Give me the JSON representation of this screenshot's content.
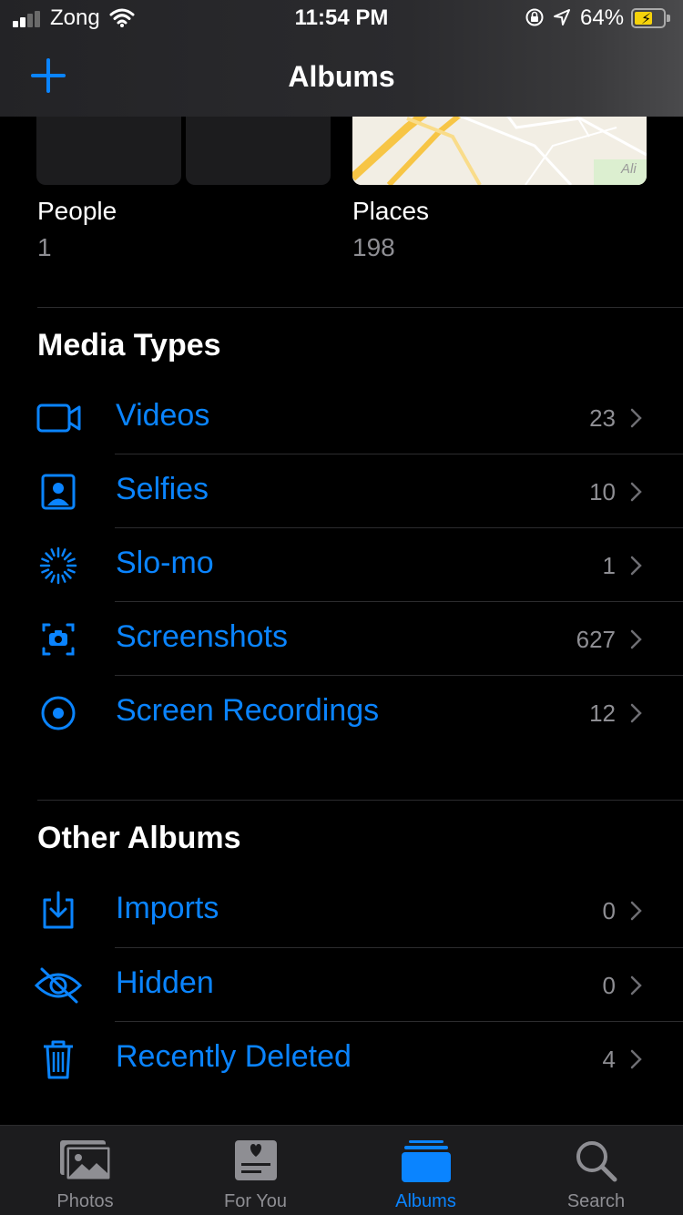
{
  "status": {
    "carrier": "Zong",
    "time": "11:54 PM",
    "battery_pct": "64%",
    "battery_level": 0.64
  },
  "nav": {
    "title": "Albums",
    "add_icon": "plus-icon"
  },
  "top_albums": [
    {
      "name": "People",
      "count": "1"
    },
    {
      "name": "Places",
      "count": "198",
      "map_label": "Ali"
    }
  ],
  "media_types": {
    "heading": "Media Types",
    "items": [
      {
        "label": "Videos",
        "count": "23",
        "icon": "video-camera-icon"
      },
      {
        "label": "Selfies",
        "count": "10",
        "icon": "selfie-portrait-icon"
      },
      {
        "label": "Slo-mo",
        "count": "1",
        "icon": "slo-mo-icon"
      },
      {
        "label": "Screenshots",
        "count": "627",
        "icon": "screenshot-icon"
      },
      {
        "label": "Screen Recordings",
        "count": "12",
        "icon": "screen-recording-icon"
      }
    ]
  },
  "other_albums": {
    "heading": "Other Albums",
    "items": [
      {
        "label": "Imports",
        "count": "0",
        "icon": "import-icon"
      },
      {
        "label": "Hidden",
        "count": "0",
        "icon": "hidden-eye-icon"
      },
      {
        "label": "Recently Deleted",
        "count": "4",
        "icon": "trash-icon"
      }
    ]
  },
  "tabs": [
    {
      "label": "Photos",
      "icon": "photos-icon",
      "active": false
    },
    {
      "label": "For You",
      "icon": "for-you-icon",
      "active": false
    },
    {
      "label": "Albums",
      "icon": "albums-icon",
      "active": true
    },
    {
      "label": "Search",
      "icon": "search-icon",
      "active": false
    }
  ],
  "colors": {
    "accent": "#0a84ff",
    "background": "#000000",
    "secondary_text": "#8e8e93"
  }
}
